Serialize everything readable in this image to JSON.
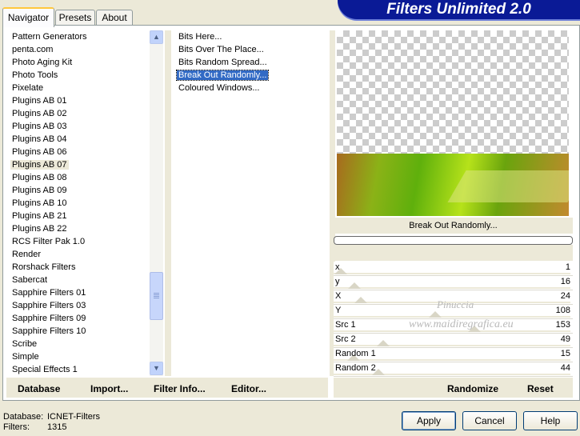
{
  "tabs": [
    "Navigator",
    "Presets",
    "About"
  ],
  "banner": "Filters Unlimited 2.0",
  "categories": [
    "Pattern Generators",
    "penta.com",
    "Photo Aging Kit",
    "Photo Tools",
    "Pixelate",
    "Plugins AB 01",
    "Plugins AB 02",
    "Plugins AB 03",
    "Plugins AB 04",
    "Plugins AB 06",
    "Plugins AB 07",
    "Plugins AB 08",
    "Plugins AB 09",
    "Plugins AB 10",
    "Plugins AB 21",
    "Plugins AB 22",
    "RCS Filter Pak 1.0",
    "Render",
    "Rorshack Filters",
    "Sabercat",
    "Sapphire Filters 01",
    "Sapphire Filters 03",
    "Sapphire Filters 09",
    "Sapphire Filters 10",
    "Scribe",
    "Simple",
    "Special Effects 1"
  ],
  "selected_category": "Plugins AB 07",
  "filters": [
    "Bits Here...",
    "Bits Over The Place...",
    "Bits Random Spread...",
    "Break Out Randomly...",
    "Coloured Windows..."
  ],
  "selected_filter": "Break Out Randomly...",
  "preview_filter_name": "Break Out Randomly...",
  "sliders": [
    {
      "label": "x",
      "value": "1",
      "level": 0.004
    },
    {
      "label": "y",
      "value": "16",
      "level": 0.063
    },
    {
      "label": "X",
      "value": "24",
      "level": 0.094
    },
    {
      "label": "Y",
      "value": "108",
      "level": 0.424
    },
    {
      "label": "Src 1",
      "value": "153",
      "level": 0.6
    },
    {
      "label": "Src 2",
      "value": "49",
      "level": 0.192
    },
    {
      "label": "Random 1",
      "value": "15",
      "level": 0.059
    },
    {
      "label": "Random 2",
      "value": "44",
      "level": 0.173
    }
  ],
  "watermark": {
    "line1": "Pinuccia",
    "line2": "www.maidiregrafica.eu"
  },
  "left_buttons": {
    "database": "Database",
    "import": "Import...",
    "filter_info": "Filter Info...",
    "editor": "Editor..."
  },
  "right_buttons": {
    "randomize": "Randomize",
    "reset": "Reset"
  },
  "status": {
    "database_label": "Database:",
    "database_value": "ICNET-Filters",
    "filters_label": "Filters:",
    "filters_value": "1315"
  },
  "dialog_buttons": {
    "apply": "Apply",
    "cancel": "Cancel",
    "help": "Help"
  },
  "icons": {
    "scroll_up": "scroll-up-icon",
    "scroll_down": "scroll-down-icon"
  }
}
